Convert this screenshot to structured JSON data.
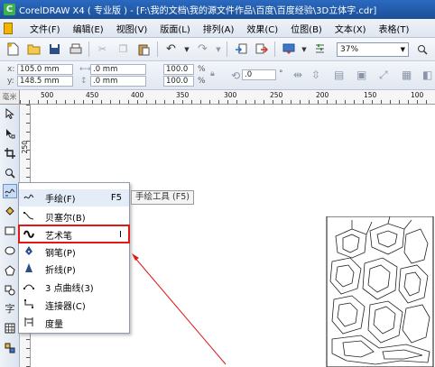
{
  "window": {
    "title": "CorelDRAW X4 ( 专业版 ) - [F:\\我的文档\\我的源文件作品\\百度\\百度经验\\3D立体字.cdr]",
    "app_icon_glyph": "C"
  },
  "menubar": {
    "items": [
      "文件(F)",
      "编辑(E)",
      "视图(V)",
      "版面(L)",
      "排列(A)",
      "效果(C)",
      "位图(B)",
      "文本(X)",
      "表格(T)"
    ]
  },
  "toolbar": {
    "zoom": "37%"
  },
  "propbar": {
    "x_label": "x:",
    "y_label": "y:",
    "x_value": "105.0 mm",
    "y_value": "148.5 mm",
    "w_value": ".0 mm",
    "h_value": ".0 mm",
    "scale_x": "100.0",
    "scale_y": "100.0",
    "scale_unit": "%",
    "rotation": ".0",
    "rotation_unit": "°"
  },
  "ruler": {
    "top_numbers": [
      "500",
      "450",
      "400",
      "350",
      "300",
      "250",
      "200",
      "150",
      "100"
    ],
    "left_number": "250",
    "corner_label": "毫米"
  },
  "flyout": {
    "items": [
      {
        "icon": "freehand-icon",
        "label": "手绘(F)",
        "shortcut": "F5"
      },
      {
        "icon": "bezier-icon",
        "label": "贝塞尔(B)",
        "shortcut": ""
      },
      {
        "icon": "artistic-media-icon",
        "label": "艺术笔",
        "shortcut": "I"
      },
      {
        "icon": "pen-icon",
        "label": "钢笔(P)",
        "shortcut": ""
      },
      {
        "icon": "polyline-icon",
        "label": "折线(P)",
        "shortcut": ""
      },
      {
        "icon": "three-point-curve-icon",
        "label": "3 点曲线(3)",
        "shortcut": ""
      },
      {
        "icon": "connector-icon",
        "label": "连接器(C)",
        "shortcut": ""
      },
      {
        "icon": "dimension-icon",
        "label": "度量",
        "shortcut": ""
      }
    ],
    "tooltip": "手绘工具 (F5)"
  },
  "colors": {
    "titlebar": "#1c4f96",
    "highlight": "#e01818",
    "arrow": "#e01818"
  }
}
